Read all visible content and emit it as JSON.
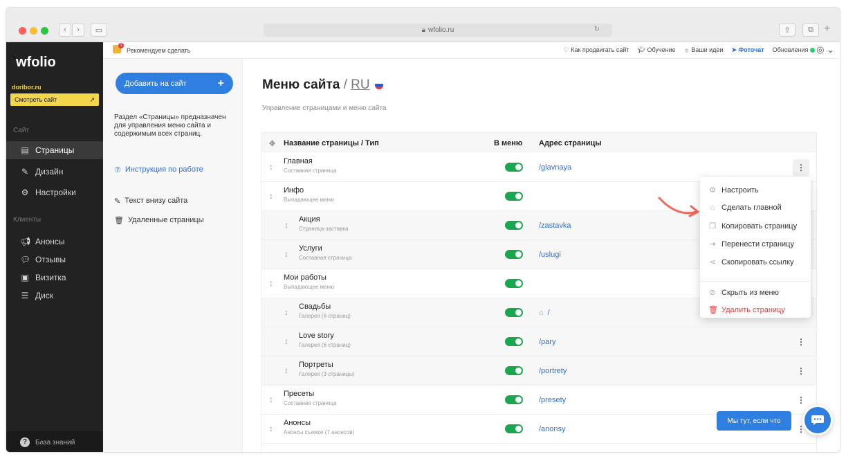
{
  "browser": {
    "url": "wfolio.ru",
    "lock_icon": "lock-icon"
  },
  "app": {
    "logo": "wfolio",
    "domain": "doribor.ru",
    "view_site": "Смотреть сайт"
  },
  "sidebar": {
    "group_site": "Сайт",
    "site_items": [
      {
        "label": "Страницы",
        "icon": "page-icon",
        "active": true
      },
      {
        "label": "Дизайн",
        "icon": "brush-icon"
      },
      {
        "label": "Настройки",
        "icon": "gear-icon"
      }
    ],
    "group_clients": "Клиенты",
    "client_items": [
      {
        "label": "Анонсы",
        "icon": "megaphone-icon"
      },
      {
        "label": "Отзывы",
        "icon": "chat-icon"
      },
      {
        "label": "Визитка",
        "icon": "card-icon"
      },
      {
        "label": "Диск",
        "icon": "disk-icon"
      }
    ],
    "knowledge": "База знаний"
  },
  "topbar": {
    "recommend": "Рекомендуем сделать",
    "notification_count": "1",
    "links": [
      "Как продвигать сайт",
      "Обучение",
      "Ваши идеи",
      "Фоточат",
      "Обновления"
    ]
  },
  "leftpanel": {
    "add_button": "Добавить на сайт",
    "description": "Раздел «Страницы» предназначен для управления меню сайта и содержимым всех страниц.",
    "instruction": "Инструкция по работе",
    "footer_text": "Текст внизу сайта",
    "deleted_pages": "Удаленные страницы"
  },
  "main": {
    "title": "Меню сайта",
    "lang": "RU",
    "subtitle": "Управление страницами и меню сайта",
    "columns": {
      "name": "Название страницы / Тип",
      "in_menu": "В меню",
      "address": "Адрес страницы"
    },
    "rows": [
      {
        "name": "Главная",
        "type": "Составная страница",
        "in_menu": true,
        "address": "/glavnaya",
        "child": false
      },
      {
        "name": "Инфо",
        "type": "Выпадающее меню",
        "in_menu": true,
        "address": "",
        "child": false
      },
      {
        "name": "Акция",
        "type": "Страница-заставка",
        "in_menu": true,
        "address": "/zastavka",
        "child": true
      },
      {
        "name": "Услуги",
        "type": "Составная страница",
        "in_menu": true,
        "address": "/uslugi",
        "child": true
      },
      {
        "name": "Мои работы",
        "type": "Выпадающее меню",
        "in_menu": true,
        "address": "",
        "child": false
      },
      {
        "name": "Свадьбы",
        "type": "Галерея (6 страниц)",
        "in_menu": true,
        "address": "/",
        "home": true,
        "child": true
      },
      {
        "name": "Love story",
        "type": "Галерея (6 страниц)",
        "in_menu": true,
        "address": "/pary",
        "child": true
      },
      {
        "name": "Портреты",
        "type": "Галерея (3 страницы)",
        "in_menu": true,
        "address": "/portrety",
        "child": true
      },
      {
        "name": "Пресеты",
        "type": "Составная страница",
        "in_menu": true,
        "address": "/presety",
        "child": false
      },
      {
        "name": "Анонсы",
        "type": "Анонсы съемок (7 анонсов)",
        "in_menu": true,
        "address": "/anonsy",
        "child": false
      }
    ]
  },
  "context_menu": {
    "items": [
      {
        "label": "Настроить",
        "icon": "gear-icon"
      },
      {
        "label": "Сделать главной",
        "icon": "home-icon"
      },
      {
        "label": "Копировать страницу",
        "icon": "copy-icon"
      },
      {
        "label": "Перенести страницу",
        "icon": "move-icon"
      },
      {
        "label": "Скопировать ссылку",
        "icon": "share-icon"
      },
      {
        "label": "Скрыть из меню",
        "icon": "hide-icon"
      },
      {
        "label": "Удалить страницу",
        "icon": "trash-icon",
        "danger": true
      }
    ]
  },
  "chat": {
    "label": "Мы тут, если что"
  },
  "colors": {
    "accent": "#2f7fe0",
    "toggle_on": "#1aa64e",
    "sidebar": "#222222",
    "highlight": "#f3d64c",
    "danger": "#e33b3b",
    "arrow": "#f0695a"
  }
}
